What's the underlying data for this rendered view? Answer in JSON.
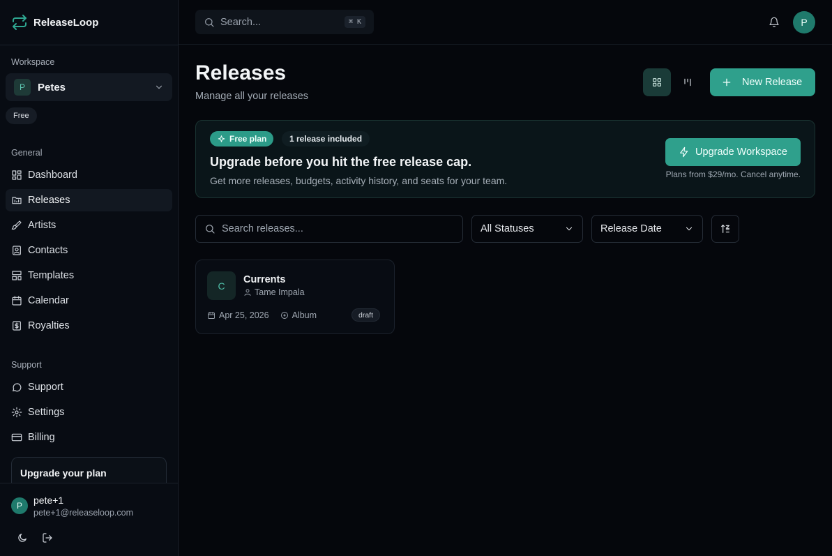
{
  "app": {
    "name": "ReleaseLoop"
  },
  "workspace": {
    "label": "Workspace",
    "avatar": "P",
    "name": "Petes",
    "plan": "Free"
  },
  "sidebar": {
    "general_label": "General",
    "general_items": [
      {
        "label": "Dashboard",
        "icon": "dashboard-icon"
      },
      {
        "label": "Releases",
        "icon": "releases-icon",
        "active": true
      },
      {
        "label": "Artists",
        "icon": "brush-icon"
      },
      {
        "label": "Contacts",
        "icon": "contacts-icon"
      },
      {
        "label": "Templates",
        "icon": "templates-icon"
      },
      {
        "label": "Calendar",
        "icon": "calendar-icon"
      },
      {
        "label": "Royalties",
        "icon": "dollar-icon"
      }
    ],
    "support_label": "Support",
    "support_items": [
      {
        "label": "Support",
        "icon": "chat-icon"
      },
      {
        "label": "Settings",
        "icon": "gear-icon"
      },
      {
        "label": "Billing",
        "icon": "credit-card-icon"
      }
    ],
    "upgrade_card_title": "Upgrade your plan"
  },
  "user": {
    "avatar": "P",
    "name": "pete+1",
    "email": "pete+1@releaseloop.com"
  },
  "topbar": {
    "search_placeholder": "Search...",
    "shortcut": "⌘ K",
    "avatar": "P"
  },
  "page": {
    "title": "Releases",
    "subtitle": "Manage all your releases",
    "new_release_label": "New Release"
  },
  "banner": {
    "plan_pill": "Free plan",
    "included_pill": "1 release included",
    "title": "Upgrade before you hit the free release cap.",
    "description": "Get more releases, budgets, activity history, and seats for your team.",
    "button_label": "Upgrade Workspace",
    "note": "Plans from $29/mo. Cancel anytime."
  },
  "filters": {
    "search_placeholder": "Search releases...",
    "status_selected": "All Statuses",
    "sort_selected": "Release Date"
  },
  "releases": [
    {
      "cover_letter": "C",
      "title": "Currents",
      "artist": "Tame Impala",
      "date": "Apr 25, 2026",
      "type": "Album",
      "status": "draft"
    }
  ],
  "colors": {
    "accent": "#2fa08c",
    "background": "#05070c",
    "sidebar": "#080c13"
  }
}
